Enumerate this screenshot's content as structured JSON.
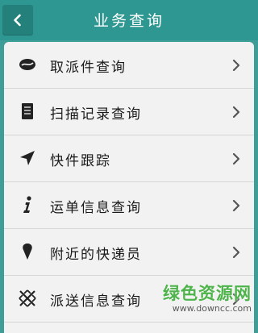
{
  "header": {
    "title": "业务查询",
    "back_icon": "chevron-left-icon"
  },
  "menu": [
    {
      "label": "取派件查询",
      "icon": "bean-icon"
    },
    {
      "label": "扫描记录查询",
      "icon": "document-icon"
    },
    {
      "label": "快件跟踪",
      "icon": "navigation-arrow-icon"
    },
    {
      "label": "运单信息查询",
      "icon": "info-icon"
    },
    {
      "label": "附近的快递员",
      "icon": "location-pin-icon"
    },
    {
      "label": "派送信息查询",
      "icon": "cross-arrows-icon"
    }
  ],
  "watermark": {
    "text": "绿色资源网",
    "url": "www.downcc.com"
  },
  "colors": {
    "header": "#2f9792",
    "panel": "#f2f2f2",
    "watermark": "#4db34a"
  }
}
